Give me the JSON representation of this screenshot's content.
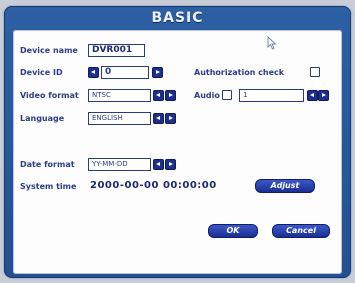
{
  "window": {
    "title": "BASIC"
  },
  "device_name": {
    "label": "Device name",
    "value": "DVR001"
  },
  "device_id": {
    "label": "Device ID",
    "value": "0"
  },
  "authorization": {
    "label": "Authorization check"
  },
  "video_format": {
    "label": "Video format",
    "value": "NTSC"
  },
  "audio": {
    "label": "Audio",
    "value": "1"
  },
  "language": {
    "label": "Language",
    "value": "ENGLISH"
  },
  "date_format": {
    "label": "Date format",
    "value": "YY-MM-DD"
  },
  "system_time": {
    "label": "System time",
    "value": "2000-00-00 00:00:00",
    "adjust_label": "Adjust"
  },
  "buttons": {
    "ok": "OK",
    "cancel": "Cancel"
  }
}
